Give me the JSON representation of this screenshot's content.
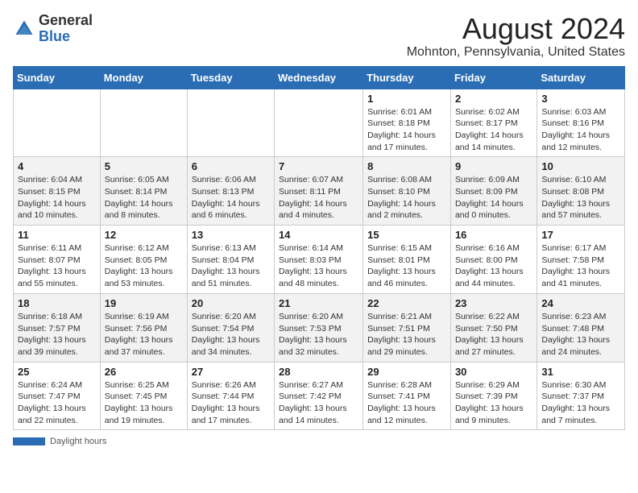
{
  "header": {
    "logo_general": "General",
    "logo_blue": "Blue",
    "title": "August 2024",
    "subtitle": "Mohnton, Pennsylvania, United States"
  },
  "days_of_week": [
    "Sunday",
    "Monday",
    "Tuesday",
    "Wednesday",
    "Thursday",
    "Friday",
    "Saturday"
  ],
  "weeks": [
    [
      {
        "num": "",
        "info": ""
      },
      {
        "num": "",
        "info": ""
      },
      {
        "num": "",
        "info": ""
      },
      {
        "num": "",
        "info": ""
      },
      {
        "num": "1",
        "info": "Sunrise: 6:01 AM\nSunset: 8:18 PM\nDaylight: 14 hours and 17 minutes."
      },
      {
        "num": "2",
        "info": "Sunrise: 6:02 AM\nSunset: 8:17 PM\nDaylight: 14 hours and 14 minutes."
      },
      {
        "num": "3",
        "info": "Sunrise: 6:03 AM\nSunset: 8:16 PM\nDaylight: 14 hours and 12 minutes."
      }
    ],
    [
      {
        "num": "4",
        "info": "Sunrise: 6:04 AM\nSunset: 8:15 PM\nDaylight: 14 hours and 10 minutes."
      },
      {
        "num": "5",
        "info": "Sunrise: 6:05 AM\nSunset: 8:14 PM\nDaylight: 14 hours and 8 minutes."
      },
      {
        "num": "6",
        "info": "Sunrise: 6:06 AM\nSunset: 8:13 PM\nDaylight: 14 hours and 6 minutes."
      },
      {
        "num": "7",
        "info": "Sunrise: 6:07 AM\nSunset: 8:11 PM\nDaylight: 14 hours and 4 minutes."
      },
      {
        "num": "8",
        "info": "Sunrise: 6:08 AM\nSunset: 8:10 PM\nDaylight: 14 hours and 2 minutes."
      },
      {
        "num": "9",
        "info": "Sunrise: 6:09 AM\nSunset: 8:09 PM\nDaylight: 14 hours and 0 minutes."
      },
      {
        "num": "10",
        "info": "Sunrise: 6:10 AM\nSunset: 8:08 PM\nDaylight: 13 hours and 57 minutes."
      }
    ],
    [
      {
        "num": "11",
        "info": "Sunrise: 6:11 AM\nSunset: 8:07 PM\nDaylight: 13 hours and 55 minutes."
      },
      {
        "num": "12",
        "info": "Sunrise: 6:12 AM\nSunset: 8:05 PM\nDaylight: 13 hours and 53 minutes."
      },
      {
        "num": "13",
        "info": "Sunrise: 6:13 AM\nSunset: 8:04 PM\nDaylight: 13 hours and 51 minutes."
      },
      {
        "num": "14",
        "info": "Sunrise: 6:14 AM\nSunset: 8:03 PM\nDaylight: 13 hours and 48 minutes."
      },
      {
        "num": "15",
        "info": "Sunrise: 6:15 AM\nSunset: 8:01 PM\nDaylight: 13 hours and 46 minutes."
      },
      {
        "num": "16",
        "info": "Sunrise: 6:16 AM\nSunset: 8:00 PM\nDaylight: 13 hours and 44 minutes."
      },
      {
        "num": "17",
        "info": "Sunrise: 6:17 AM\nSunset: 7:58 PM\nDaylight: 13 hours and 41 minutes."
      }
    ],
    [
      {
        "num": "18",
        "info": "Sunrise: 6:18 AM\nSunset: 7:57 PM\nDaylight: 13 hours and 39 minutes."
      },
      {
        "num": "19",
        "info": "Sunrise: 6:19 AM\nSunset: 7:56 PM\nDaylight: 13 hours and 37 minutes."
      },
      {
        "num": "20",
        "info": "Sunrise: 6:20 AM\nSunset: 7:54 PM\nDaylight: 13 hours and 34 minutes."
      },
      {
        "num": "21",
        "info": "Sunrise: 6:20 AM\nSunset: 7:53 PM\nDaylight: 13 hours and 32 minutes."
      },
      {
        "num": "22",
        "info": "Sunrise: 6:21 AM\nSunset: 7:51 PM\nDaylight: 13 hours and 29 minutes."
      },
      {
        "num": "23",
        "info": "Sunrise: 6:22 AM\nSunset: 7:50 PM\nDaylight: 13 hours and 27 minutes."
      },
      {
        "num": "24",
        "info": "Sunrise: 6:23 AM\nSunset: 7:48 PM\nDaylight: 13 hours and 24 minutes."
      }
    ],
    [
      {
        "num": "25",
        "info": "Sunrise: 6:24 AM\nSunset: 7:47 PM\nDaylight: 13 hours and 22 minutes."
      },
      {
        "num": "26",
        "info": "Sunrise: 6:25 AM\nSunset: 7:45 PM\nDaylight: 13 hours and 19 minutes."
      },
      {
        "num": "27",
        "info": "Sunrise: 6:26 AM\nSunset: 7:44 PM\nDaylight: 13 hours and 17 minutes."
      },
      {
        "num": "28",
        "info": "Sunrise: 6:27 AM\nSunset: 7:42 PM\nDaylight: 13 hours and 14 minutes."
      },
      {
        "num": "29",
        "info": "Sunrise: 6:28 AM\nSunset: 7:41 PM\nDaylight: 13 hours and 12 minutes."
      },
      {
        "num": "30",
        "info": "Sunrise: 6:29 AM\nSunset: 7:39 PM\nDaylight: 13 hours and 9 minutes."
      },
      {
        "num": "31",
        "info": "Sunrise: 6:30 AM\nSunset: 7:37 PM\nDaylight: 13 hours and 7 minutes."
      }
    ]
  ],
  "footer": {
    "label": "Daylight hours"
  }
}
